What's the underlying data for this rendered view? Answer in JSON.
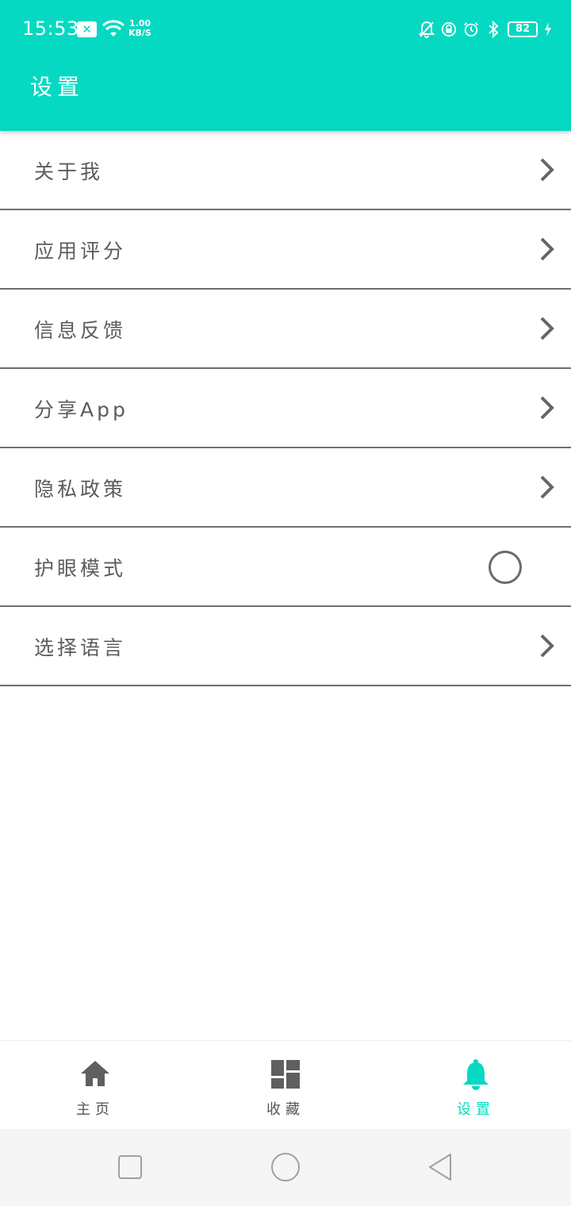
{
  "status_bar": {
    "time": "15:53",
    "x_badge": "✕",
    "speed_value": "1.00",
    "speed_unit": "KB/S",
    "battery": "82"
  },
  "header": {
    "title": "设置"
  },
  "settings": {
    "items": [
      {
        "label": "关于我",
        "control": "chevron"
      },
      {
        "label": "应用评分",
        "control": "chevron"
      },
      {
        "label": "信息反馈",
        "control": "chevron"
      },
      {
        "label": "分享App",
        "control": "chevron"
      },
      {
        "label": "隐私政策",
        "control": "chevron"
      },
      {
        "label": "护眼模式",
        "control": "toggle",
        "checked": false
      },
      {
        "label": "选择语言",
        "control": "chevron"
      }
    ]
  },
  "bottom_nav": {
    "items": [
      {
        "label": "主页",
        "icon": "home-icon",
        "active": false
      },
      {
        "label": "收藏",
        "icon": "dashboard-icon",
        "active": false
      },
      {
        "label": "设置",
        "icon": "bell-icon",
        "active": true
      }
    ]
  },
  "colors": {
    "accent": "#05d9c2",
    "text": "#5c5c5c",
    "divider": "#6f6f6f",
    "nav_inactive": "#555555"
  }
}
